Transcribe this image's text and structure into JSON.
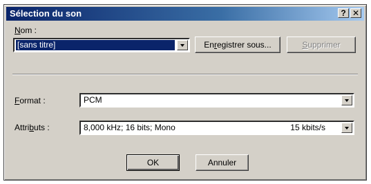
{
  "window": {
    "title": "Sélection du son",
    "help_label": "?",
    "close_label": "✕"
  },
  "name": {
    "label_accel": "N",
    "label_rest": "om :",
    "value": "[sans titre]"
  },
  "buttons": {
    "save_as_pre": "En",
    "save_as_accel": "r",
    "save_as_post": "egistrer sous...",
    "delete_accel": "S",
    "delete_rest": "upprimer",
    "ok": "OK",
    "cancel": "Annuler"
  },
  "format": {
    "label_accel": "F",
    "label_rest": "ormat :",
    "value": "PCM"
  },
  "attributes": {
    "label_pre": "Attri",
    "label_accel": "b",
    "label_post": "uts :",
    "value": "8,000 kHz; 16 bits; Mono",
    "rate": "15 kbits/s"
  },
  "colors": {
    "face": "#d4d0c8",
    "title_start": "#0a246a",
    "title_end": "#a6caf0",
    "selection": "#0a246a"
  }
}
